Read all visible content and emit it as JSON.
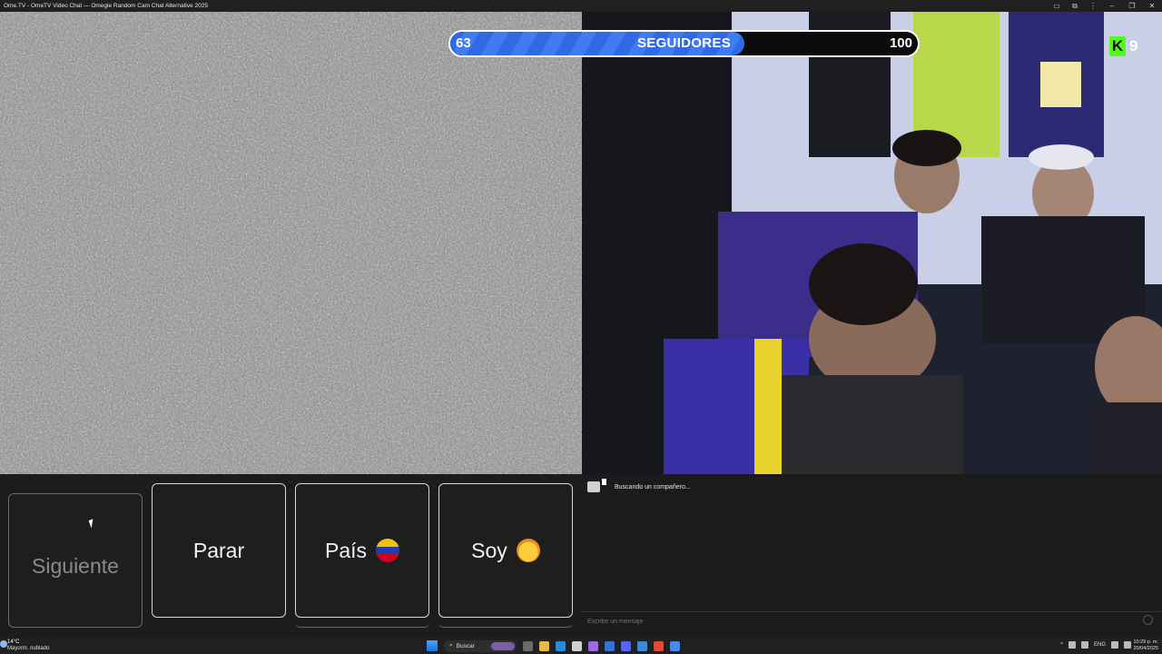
{
  "window": {
    "title": "Ome.TV - OmeTV Video Chat — Omegle Random Cam Chat Alternative 2025"
  },
  "overlay": {
    "progress": {
      "min": "63",
      "label": "SEGUIDORES",
      "max": "100",
      "fraction": 0.63,
      "fill_color": "#3b78ee"
    },
    "kick": {
      "logo_letter": "K",
      "count": "9",
      "color": "#53fc18"
    }
  },
  "controls": {
    "next_label": "Siguiente",
    "stop_label": "Parar",
    "country_label": "País",
    "country_flag": "flag-venezuela-icon",
    "gender_label": "Soy",
    "gender_icon": "woman-emoji-icon"
  },
  "chat": {
    "status": "Buscando un compañero...",
    "input_placeholder": "Escribe un mensaje"
  },
  "taskbar": {
    "weather_temp": "14°C",
    "weather_desc": "Mayorm. nublado",
    "search_label": "Buscar",
    "tray_lang": "ENG",
    "time": "10:29 p. m.",
    "date": "20/04/2025"
  }
}
